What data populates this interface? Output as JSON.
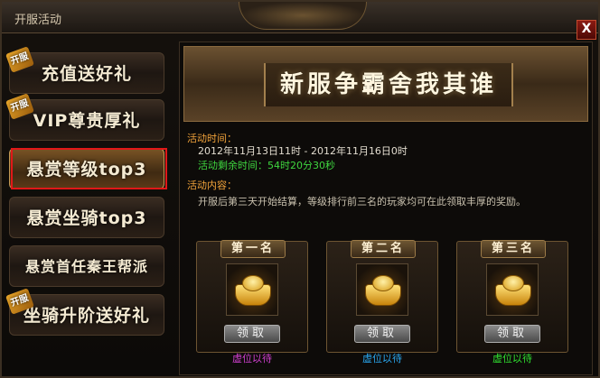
{
  "window": {
    "title": "开服活动",
    "close_label": "X"
  },
  "sidebar": {
    "tag_label": "开服",
    "items": [
      {
        "label": "充值送好礼",
        "tagged": true
      },
      {
        "label": "VIP尊贵厚礼",
        "tagged": true
      },
      {
        "label": "悬赏等级top3",
        "tagged": false
      },
      {
        "label": "悬赏坐骑top3",
        "tagged": false
      },
      {
        "label": "悬赏首任秦王帮派",
        "tagged": false
      },
      {
        "label": "坐骑升阶送好礼",
        "tagged": true
      }
    ]
  },
  "banner": {
    "title": "新服争霸舍我其谁"
  },
  "event": {
    "time_label": "活动时间：",
    "time_range": "2012年11月13日11时 - 2012年11月16日0时",
    "remaining": "活动剩余时间：54时20分30秒",
    "content_label": "活动内容：",
    "content": "开服后第三天开始结算，等级排行前三名的玩家均可在此领取丰厚的奖励。"
  },
  "rewards": [
    {
      "rank": "第一名",
      "claim": "领取",
      "holder": "虚位以待",
      "holder_color": "#d040d0"
    },
    {
      "rank": "第二名",
      "claim": "领取",
      "holder": "虚位以待",
      "holder_color": "#2aa8f0"
    },
    {
      "rank": "第三名",
      "claim": "领取",
      "holder": "虚位以待",
      "holder_color": "#30e030"
    }
  ]
}
